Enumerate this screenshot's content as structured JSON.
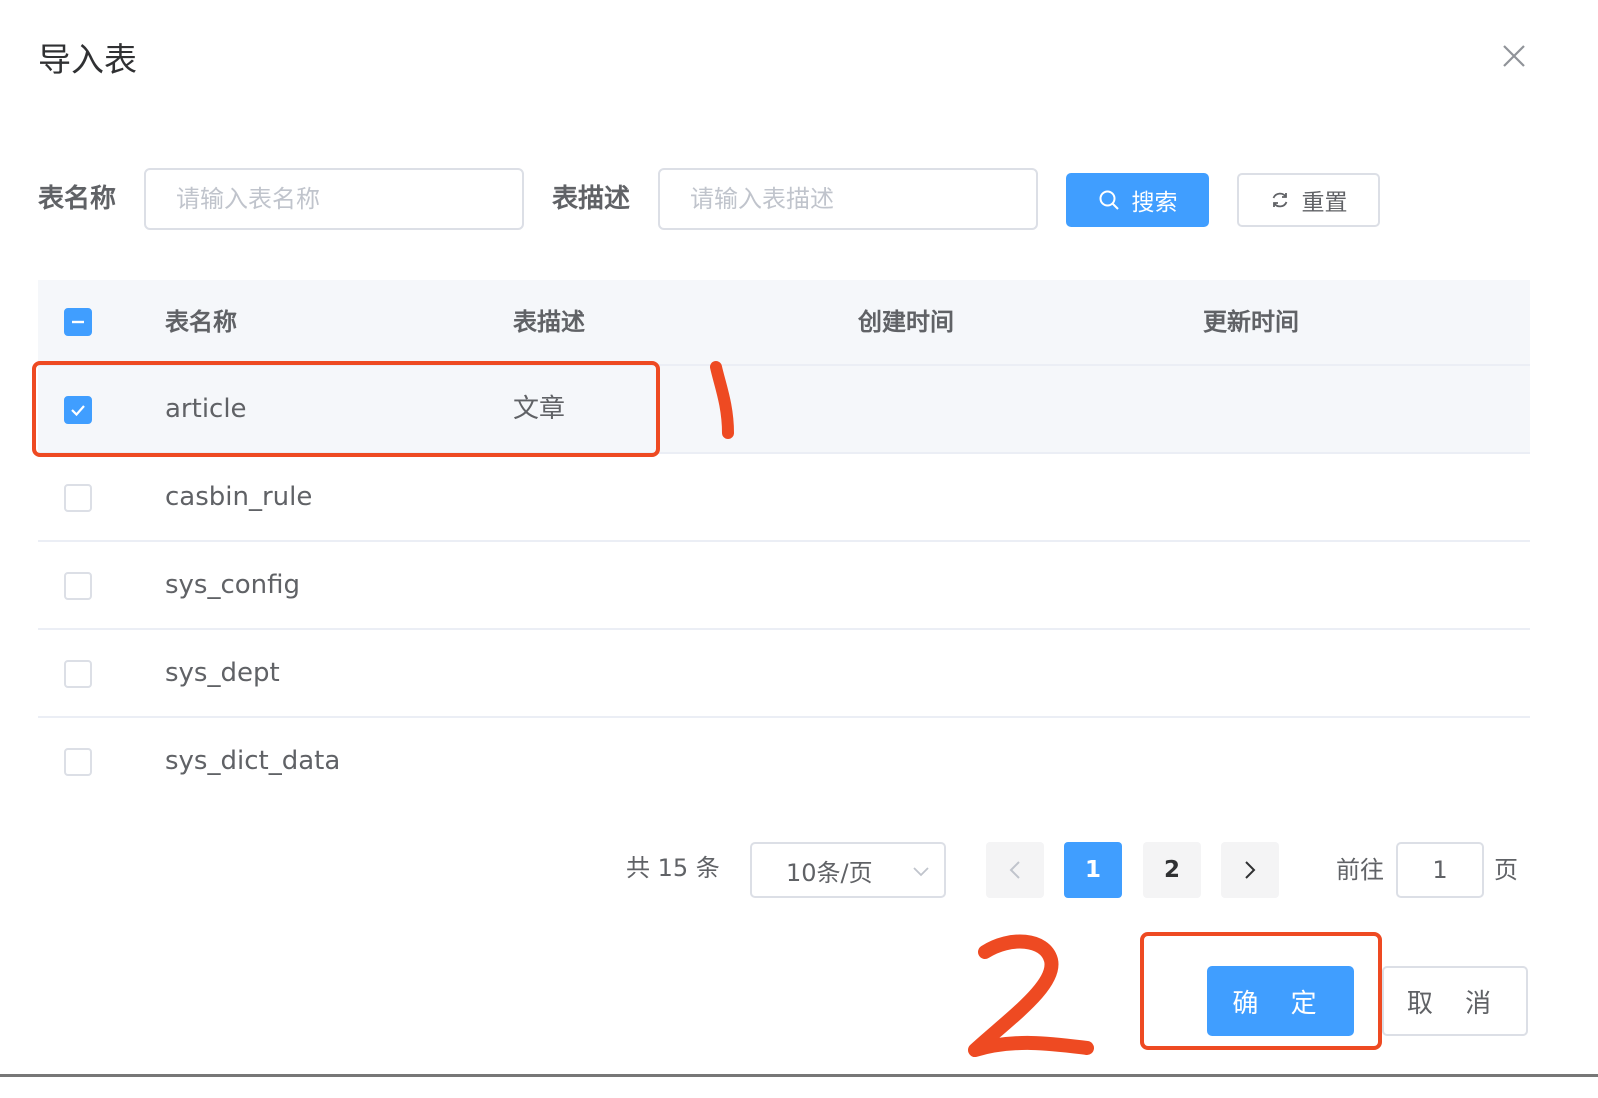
{
  "dialog": {
    "title": "导入表"
  },
  "search": {
    "name_label": "表名称",
    "name_placeholder": "请输入表名称",
    "desc_label": "表描述",
    "desc_placeholder": "请输入表描述",
    "search_button": "搜索",
    "reset_button": "重置"
  },
  "table": {
    "columns": [
      "表名称",
      "表描述",
      "创建时间",
      "更新时间"
    ],
    "rows": [
      {
        "name": "article",
        "desc": "文章",
        "created": "",
        "updated": "",
        "checked": true
      },
      {
        "name": "casbin_rule",
        "desc": "",
        "created": "",
        "updated": "",
        "checked": false
      },
      {
        "name": "sys_config",
        "desc": "",
        "created": "",
        "updated": "",
        "checked": false
      },
      {
        "name": "sys_dept",
        "desc": "",
        "created": "",
        "updated": "",
        "checked": false
      },
      {
        "name": "sys_dict_data",
        "desc": "",
        "created": "",
        "updated": "",
        "checked": false
      }
    ]
  },
  "pagination": {
    "total_text": "共 15 条",
    "page_size": "10条/页",
    "pages": [
      "1",
      "2"
    ],
    "current_page": "1",
    "goto_label": "前往",
    "goto_value": "1",
    "page_suffix": "页"
  },
  "footer": {
    "confirm": "确 定",
    "cancel": "取 消"
  },
  "colors": {
    "primary": "#409eff",
    "annotation": "#ee4a22"
  }
}
